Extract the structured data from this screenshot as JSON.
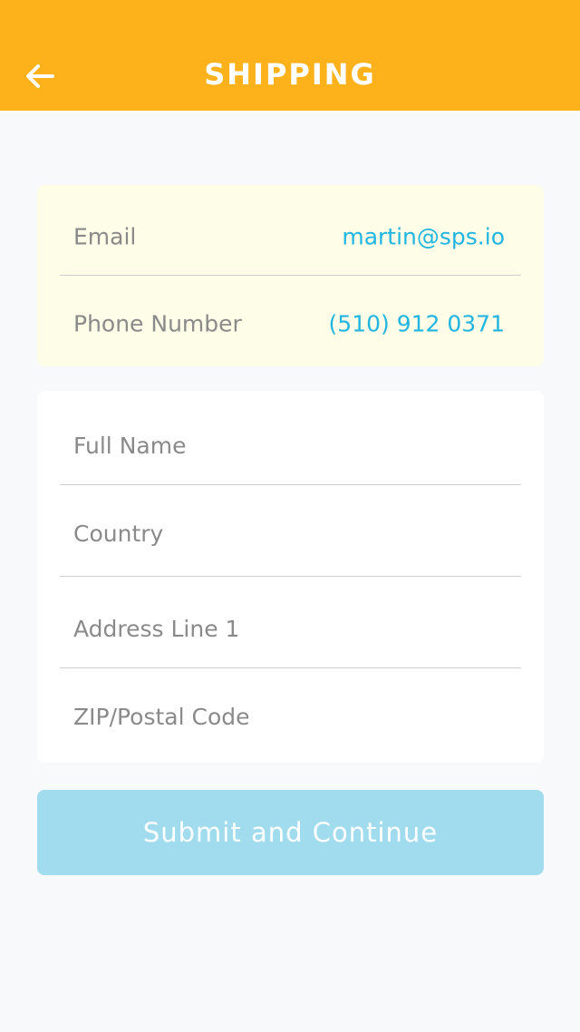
{
  "header": {
    "title": "SHIPPING",
    "back_icon": "arrow-left-icon",
    "background": "#fdb11b"
  },
  "contact": {
    "email_label": "Email",
    "email_value": "martin@sps.io",
    "phone_label": "Phone Number",
    "phone_value": "(510) 912 0371"
  },
  "form": {
    "full_name_placeholder": "Full Name",
    "country_placeholder": "Country",
    "address_placeholder": "Address Line 1",
    "zip_placeholder": "ZIP/Postal Code"
  },
  "submit": {
    "label": "Submit and Continue"
  },
  "colors": {
    "accent": "#22b5e0",
    "button": "#a1dbee",
    "contact_bg": "#fefde8"
  }
}
